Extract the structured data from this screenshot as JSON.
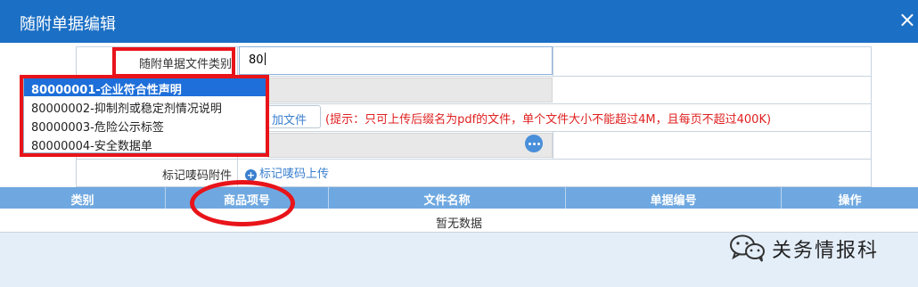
{
  "dialog": {
    "title": "随附单据编辑",
    "close_icon": "×"
  },
  "form": {
    "doc_type_label": "随附单据文件类别",
    "doc_type_value": "80",
    "add_file_label": "加文件",
    "hint": "(提示：只可上传后缀名为pdf的文件，单个文件大小不能超过4M，且每页不超过400K)",
    "qr_label": "标记唛码附件",
    "qr_upload": "标记唛码上传"
  },
  "dropdown": {
    "options": [
      "80000001-企业符合性声明",
      "80000002-抑制剂或稳定剂情况说明",
      "80000003-危险公示标签",
      "80000004-安全数据单"
    ],
    "selected_index": 0
  },
  "table": {
    "columns": [
      "类别",
      "商品项号",
      "文件名称",
      "单据编号",
      "操作"
    ],
    "empty_text": "暂无数据"
  },
  "watermark": {
    "text": "关务情报科"
  },
  "colors": {
    "titlebar": "#1b6fc4",
    "header": "#6fa8e0",
    "annotation": "#e8141a",
    "link": "#3a7fcf"
  }
}
